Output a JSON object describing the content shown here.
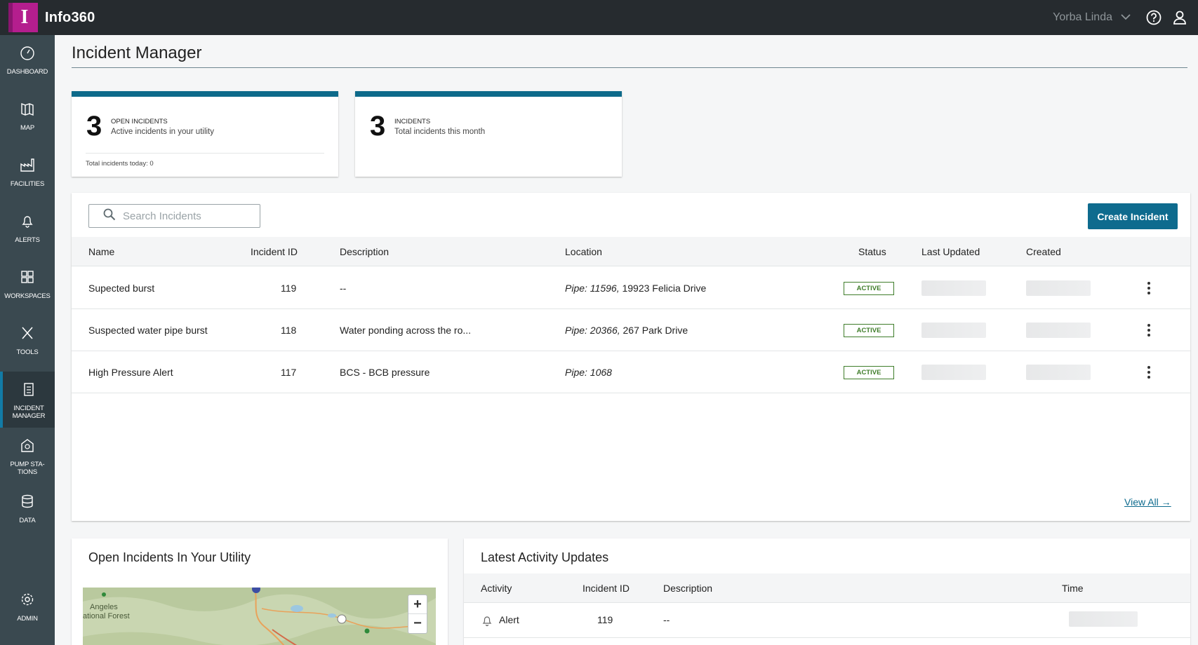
{
  "app": {
    "logo_letter": "I",
    "title": "Info360",
    "org": "Yorba Linda"
  },
  "sidebar": {
    "items": [
      {
        "label": "DASHBOARD",
        "icon": "gauge-icon"
      },
      {
        "label": "MAP",
        "icon": "map-icon"
      },
      {
        "label": "FACILITIES",
        "icon": "factory-icon"
      },
      {
        "label": "ALERTS",
        "icon": "bell-icon"
      },
      {
        "label": "WORKSPACES",
        "icon": "grid-icon"
      },
      {
        "label": "TOOLS",
        "icon": "tools-icon"
      },
      {
        "label": "INCIDENT MANAGER",
        "icon": "clipboard-icon",
        "active": true
      },
      {
        "label": "PUMP STA-TIONS",
        "icon": "pump-icon"
      },
      {
        "label": "DATA",
        "icon": "database-icon"
      },
      {
        "label": "ADMIN",
        "icon": "gear-icon"
      }
    ]
  },
  "page": {
    "title": "Incident Manager"
  },
  "stats": [
    {
      "value": "3",
      "label": "OPEN INCIDENTS",
      "sub": "Active incidents in your utility",
      "footer": "Total incidents today: 0"
    },
    {
      "value": "3",
      "label": "INCIDENTS",
      "sub": "Total incidents this month"
    }
  ],
  "incidents": {
    "search_placeholder": "Search Incidents",
    "create_label": "Create Incident",
    "columns": [
      "Name",
      "Incident ID",
      "Description",
      "Location",
      "Status",
      "Last Updated",
      "Created"
    ],
    "rows": [
      {
        "name": "Supected burst",
        "id": "119",
        "description": "--",
        "loc_prefix": "Pipe: 11596,",
        "loc_rest": " 19923 Felicia Drive",
        "status": "ACTIVE"
      },
      {
        "name": "Suspected water pipe burst",
        "id": "118",
        "description": "Water ponding across the ro...",
        "loc_prefix": "Pipe: 20366,",
        "loc_rest": " 267 Park Drive",
        "status": "ACTIVE"
      },
      {
        "name": "High Pressure Alert",
        "id": "117",
        "description": "BCS - BCB pressure",
        "loc_prefix": "Pipe: 1068",
        "loc_rest": "",
        "status": "ACTIVE"
      }
    ],
    "view_all": "View All →"
  },
  "map_panel": {
    "title": "Open Incidents In Your Utility",
    "labels": [
      "Angeles",
      "ational Forest"
    ],
    "zoom_in": "+",
    "zoom_out": "−"
  },
  "activity": {
    "title": "Latest Activity Updates",
    "columns": [
      "Activity",
      "Incident ID",
      "Description",
      "Time"
    ],
    "rows": [
      {
        "activity": "Alert",
        "id": "119",
        "description": "--"
      }
    ]
  },
  "colors": {
    "accent": "#0e6b8e",
    "topbar": "#262b2f",
    "sidebar": "#3a4950",
    "active_green": "#3f7d2a",
    "brand": "#b41e8e"
  }
}
